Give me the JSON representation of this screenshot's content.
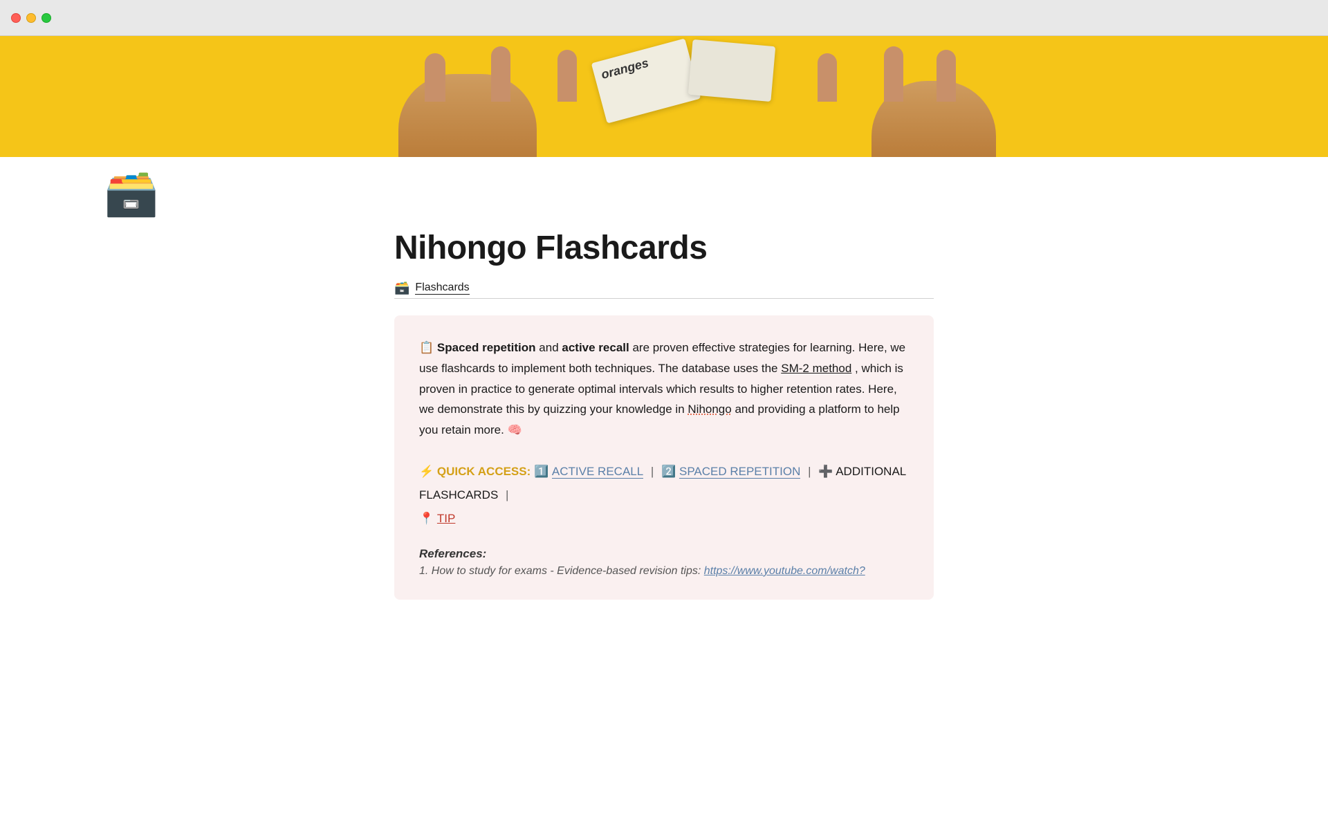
{
  "window": {
    "traffic_lights": [
      "red",
      "yellow",
      "green"
    ]
  },
  "hero": {
    "card_text": "oranges"
  },
  "page": {
    "icon": "🗃️",
    "title": "Nihongo Flashcards",
    "breadcrumb_icon": "🗃️",
    "breadcrumb_label": "Flashcards"
  },
  "info_box": {
    "paragraph": {
      "before_link": " Spaced repetition and active recall are proven effective strategies for learning. Here, we use flashcards to implement both techniques. The database uses the ",
      "link_text": "SM-2 method",
      "after_link": ", which is proven in practice to generate optimal intervals which results to higher retention rates. Here, we demonstrate this by quizzing your knowledge in Nihongo and providing a platform to help you retain more. 🧠"
    },
    "quick_access": {
      "label": "⚡ QUICK ACCESS:",
      "items": [
        {
          "number": "1️⃣",
          "label": "ACTIVE RECALL",
          "href": "#active-recall"
        },
        {
          "number": "2️⃣",
          "label": "SPACED REPETITION",
          "href": "#spaced-repetition"
        }
      ],
      "additional": "+ ADDITIONAL FLASHCARDS",
      "tip_label": "📍 TIP",
      "tip_href": "#tip"
    }
  },
  "references": {
    "title": "References:",
    "items": [
      {
        "text": "1. How to study for exams - Evidence-based revision tips:",
        "link_text": "https://www.youtube.com/watch?",
        "link_href": "https://www.youtube.com/watch?"
      }
    ]
  }
}
